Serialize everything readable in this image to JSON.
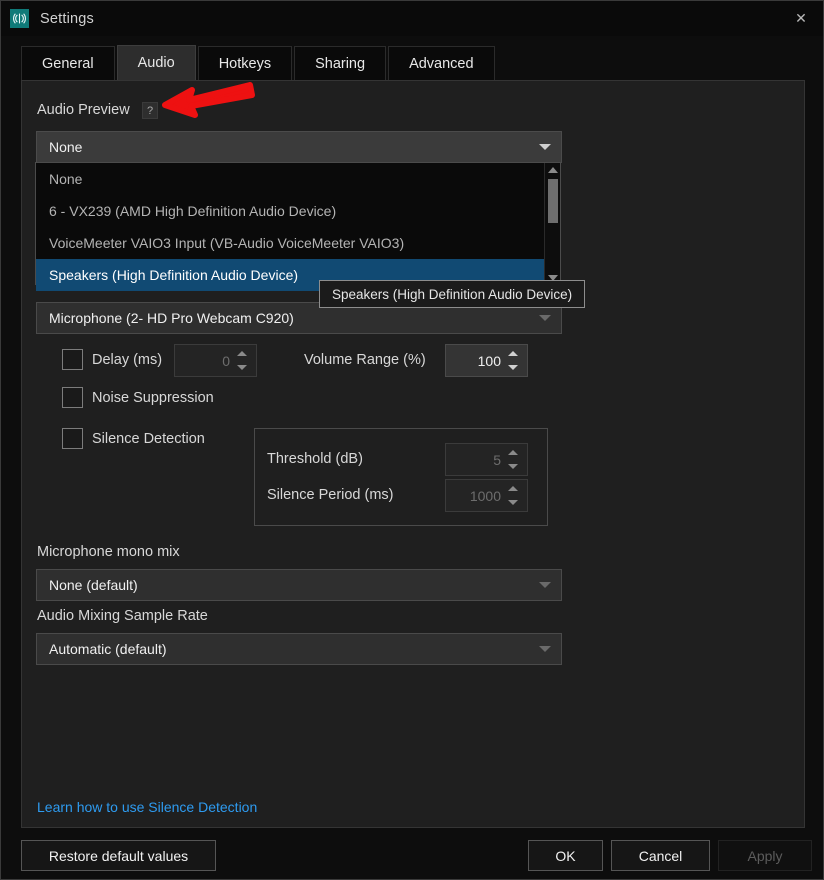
{
  "window": {
    "title": "Settings",
    "app_icon": "audio-waves-icon",
    "close_label": "✕",
    "accent_teal": "#0f7a78",
    "selection_blue": "#114a73",
    "link_blue": "#2e9bf0"
  },
  "tabs": [
    {
      "label": "General",
      "active": false
    },
    {
      "label": "Audio",
      "active": true
    },
    {
      "label": "Hotkeys",
      "active": false
    },
    {
      "label": "Sharing",
      "active": false
    },
    {
      "label": "Advanced",
      "active": false
    }
  ],
  "audio_preview": {
    "label": "Audio Preview",
    "help_glyph": "?",
    "selected": "None",
    "dropdown_open": true,
    "options": [
      "None",
      "6 - VX239 (AMD High Definition Audio Device)",
      "VoiceMeeter VAIO3 Input (VB-Audio VoiceMeeter VAIO3)",
      "Speakers (High Definition Audio Device)"
    ],
    "highlighted_option": "Speakers (High Definition Audio Device)",
    "tooltip": "Speakers (High Definition Audio Device)"
  },
  "microphone": {
    "label": "Microphone",
    "selected": "Microphone (2- HD Pro Webcam C920)"
  },
  "delay": {
    "checkbox_label": "Delay (ms)",
    "checked": false,
    "value": "0",
    "enabled": false
  },
  "volume_range": {
    "label": "Volume Range (%)",
    "value": "100",
    "enabled": true
  },
  "noise_suppression": {
    "label": "Noise Suppression",
    "checked": false
  },
  "silence_detection": {
    "label": "Silence Detection",
    "checked": false,
    "threshold_label": "Threshold (dB)",
    "threshold_value": "5",
    "silence_period_label": "Silence Period (ms)",
    "silence_period_value": "1000",
    "fields_enabled": false
  },
  "mono_mix": {
    "label": "Microphone mono mix",
    "selected": "None (default)"
  },
  "sample_rate": {
    "label": "Audio Mixing Sample Rate",
    "selected": "Automatic (default)"
  },
  "help_link": {
    "text": "Learn how to use Silence Detection"
  },
  "footer": {
    "restore": "Restore default values",
    "ok": "OK",
    "cancel": "Cancel",
    "apply": "Apply",
    "apply_enabled": false
  },
  "annotation": {
    "arrow_color": "#ee1111",
    "direction": "left"
  }
}
